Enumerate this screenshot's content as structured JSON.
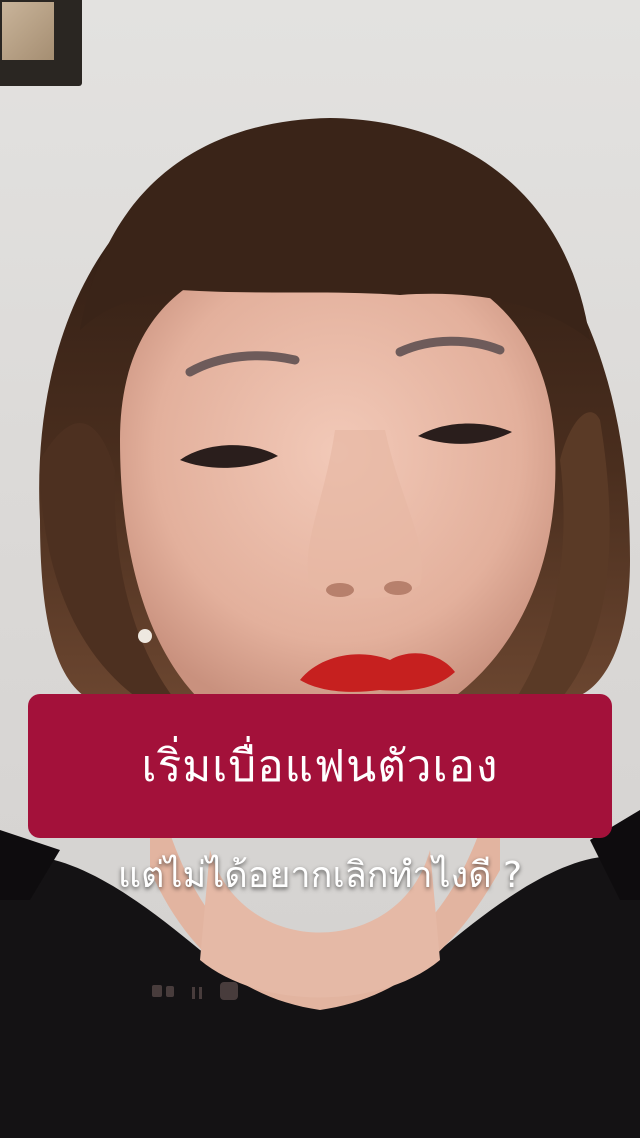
{
  "caption": {
    "headline": "เริ่มเบื่อแฟนตัวเอง",
    "subline": "แต่ไม่ได้อยากเลิกทำไงดี ?"
  },
  "colors": {
    "caption_box": "#a3113a",
    "caption_text": "#ffffff"
  }
}
